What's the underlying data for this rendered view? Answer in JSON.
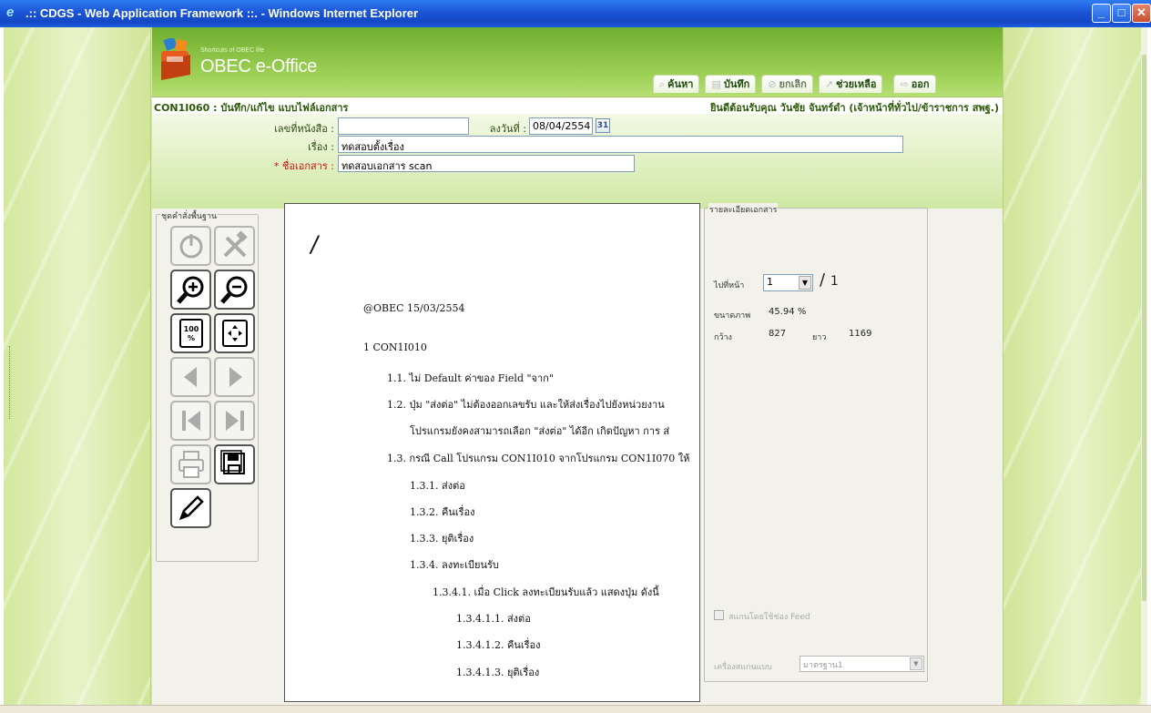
{
  "window": {
    "title": ".:: CDGS - Web Application Framework ::. - Windows Internet Explorer"
  },
  "logo": {
    "tagline": "Shortcuts of OBEC life",
    "title": "OBEC e-Office"
  },
  "nav": {
    "search": "ค้นหา",
    "save": "บันทึก",
    "cancel": "ยกเลิก",
    "help": "ช่วยเหลือ",
    "exit": "ออก"
  },
  "bar": {
    "code": "CON1I060 : บันทึก/แก้ไข แบบไฟล์เอกสาร",
    "welcome": "ยินดีต้อนรับคุณ วันชัย จันทร์ดำ (เจ้าหน้าที่ทั่วไป/ข้าราชการ สพฐ.)"
  },
  "form": {
    "doc_no_label": "เลขที่หนังสือ :",
    "doc_no_value": "",
    "date_label": "ลงวันที่ :",
    "date_value": "08/04/2554",
    "cal_label": "31",
    "subject_label": "เรื่อง :",
    "subject_value": "ทดสอบตั้งเรื่อง",
    "docname_star": "*",
    "docname_label": "ชื่อเอกสาร :",
    "docname_value": "ทดสอบเอกสาร scan"
  },
  "toolbox": {
    "legend": "ชุดคำสั่งพื้นฐาน"
  },
  "document_lines": [
    "/",
    "@OBEC 15/03/2554",
    "1    CON1I010",
    "1.1.  ไม่ Default ค่าของ Field \"จาก\"",
    "1.2.  ปุ่ม \"ส่งต่อ\" ไม่ต้องออกเลขรับ และให้ส่งเรื่องไปยังหน่วยงาน",
    "โปรแกรมยังคงสามารถเลือก \"ส่งต่อ\" ได้อีก เกิดปัญหา การ ส่",
    "1.3.  กรณี Call โปรแกรม CON1I010 จากโปรแกรม CON1I070 ให้",
    "1.3.1.  ส่งต่อ",
    "1.3.2.  คืนเรื่อง",
    "1.3.3.  ยุติเรื่อง",
    "1.3.4.  ลงทะเบียนรับ",
    "1.3.4.1.  เมื่อ Click ลงทะเบียนรับแล้ว แสดงปุ่ม ดังนี้",
    "1.3.4.1.1.  ส่งต่อ",
    "1.3.4.1.2.  คืนเรื่อง",
    "1.3.4.1.3.  ยุติเรื่อง"
  ],
  "details": {
    "legend": "รายละเอียดเอกสาร",
    "goto_page_label": "ไปที่หน้า",
    "page_value": "1",
    "page_sep": "/",
    "page_total": "1",
    "zoom_label": "ขนาดภาพ",
    "zoom_value": "45.94",
    "zoom_unit": "%",
    "width_label": "กว้าง",
    "width_value": "827",
    "height_label": "ยาว",
    "height_value": "1169",
    "feed_label": "สแกนโดยใช้ช่อง Feed",
    "scanner_label": "เครื่องสแกนแบบ",
    "scanner_value": "มาตรฐาน1"
  },
  "colors": {
    "header": "#8cc646",
    "accent": "#2c5a09",
    "required": "#cc1111"
  }
}
